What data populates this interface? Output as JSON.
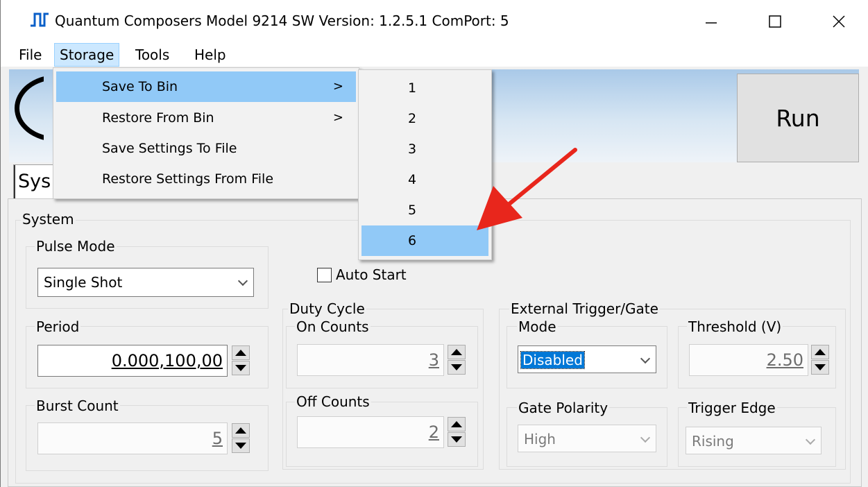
{
  "window": {
    "title": "Quantum Composers Model 9214  SW Version: 1.2.5.1 ComPort: 5",
    "controls": [
      "minimize-icon",
      "maximize-icon",
      "close-icon"
    ]
  },
  "menubar": {
    "items": [
      "File",
      "Storage",
      "Tools",
      "Help"
    ],
    "open": "Storage"
  },
  "storage_menu": {
    "items": [
      {
        "label": "Save To Bin",
        "submenu_arrow": ">",
        "highlighted": true
      },
      {
        "label": "Restore From Bin",
        "submenu_arrow": ">"
      },
      {
        "label": "Save Settings To File"
      },
      {
        "label": "Restore Settings From File"
      }
    ]
  },
  "bin_submenu": {
    "items": [
      "1",
      "2",
      "3",
      "4",
      "5",
      "6"
    ],
    "highlighted": "6"
  },
  "toolbar": {
    "run_label": "Run"
  },
  "tabs": {
    "active_partial": "Sys"
  },
  "system": {
    "group_label": "System",
    "pulse_mode": {
      "label": "Pulse Mode",
      "value": "Single Shot"
    },
    "auto_start": {
      "label": "Auto Start",
      "checked": false
    },
    "period": {
      "label": "Period",
      "value": "0.000,100,00"
    },
    "burst_count": {
      "label": "Burst Count",
      "value": "5"
    },
    "duty_cycle": {
      "label": "Duty Cycle",
      "on_counts": {
        "label": "On Counts",
        "value": "3"
      },
      "off_counts": {
        "label": "Off Counts",
        "value": "2"
      }
    },
    "external_trigger": {
      "label": "External Trigger/Gate",
      "mode": {
        "label": "Mode",
        "value": "Disabled"
      },
      "threshold": {
        "label": "Threshold (V)",
        "value": "2.50"
      },
      "gate_polarity": {
        "label": "Gate Polarity",
        "value": "High"
      },
      "trigger_edge": {
        "label": "Trigger Edge",
        "value": "Rising"
      }
    }
  },
  "annotation": {
    "arrow_color": "#e8261c"
  },
  "colors": {
    "menu_highlight": "#91c9f7",
    "selection": "#0078d7",
    "menu_open": "#cce8ff"
  }
}
